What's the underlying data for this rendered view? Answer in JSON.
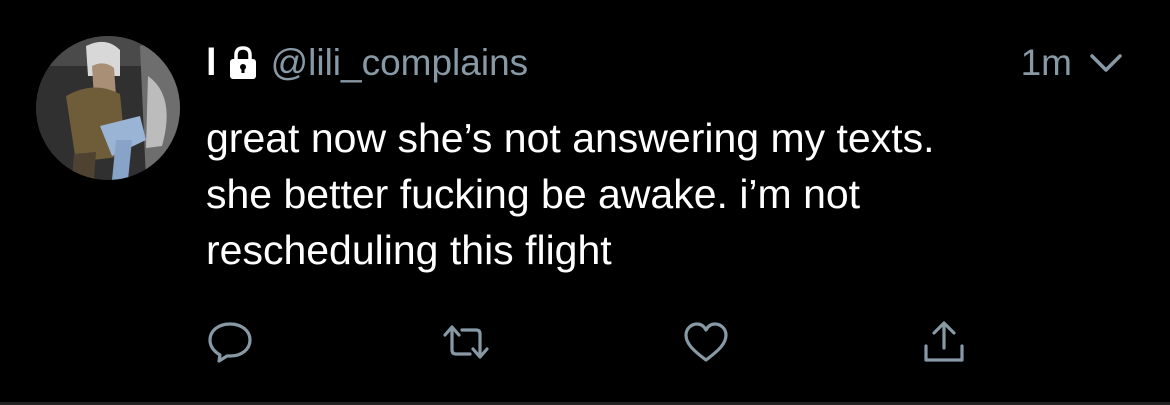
{
  "tweet": {
    "display_name": "l",
    "handle": "@lili_complains",
    "timestamp": "1m",
    "text": "great now she’s not answering my texts.\nshe better fucking be awake. i’m not\nrescheduling this flight"
  },
  "icons": {
    "protected": "lock-icon",
    "menu": "chevron-down-icon",
    "reply": "reply-icon",
    "retweet": "retweet-icon",
    "like": "heart-icon",
    "share": "share-icon"
  },
  "colors": {
    "background": "#000000",
    "text": "#ffffff",
    "secondary": "#8899a6"
  }
}
